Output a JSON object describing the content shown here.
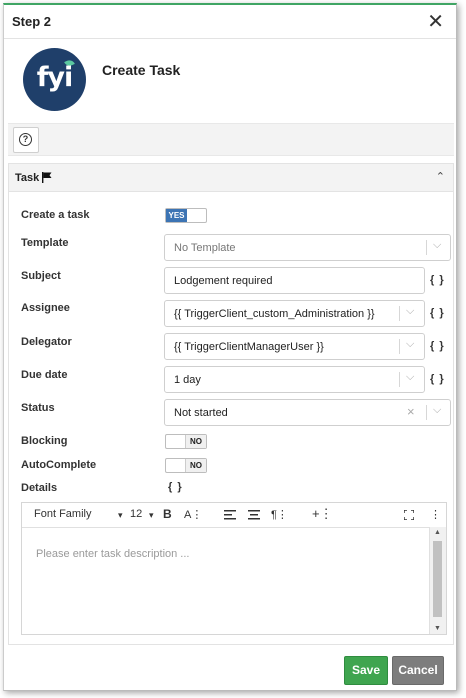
{
  "dialog": {
    "step_title": "Step 2",
    "close_label": "✕",
    "heading": "Create Task",
    "logo_text": "fyi"
  },
  "help": {
    "label": "?"
  },
  "task_panel": {
    "title": "Task",
    "collapse_icon": "chevron-up-icon",
    "fields": {
      "create_task": {
        "label": "Create a task",
        "toggle": "YES"
      },
      "template": {
        "label": "Template",
        "placeholder": "No Template"
      },
      "subject": {
        "label": "Subject",
        "value": "Lodgement required",
        "braces": "{ }"
      },
      "assignee": {
        "label": "Assignee",
        "value": "{{ TriggerClient_custom_Administration }}",
        "braces": "{ }"
      },
      "delegator": {
        "label": "Delegator",
        "value": "{{ TriggerClientManagerUser }}",
        "braces": "{ }"
      },
      "due_date": {
        "label": "Due date",
        "value": "1 day",
        "braces": "{ }"
      },
      "status": {
        "label": "Status",
        "value": "Not started"
      },
      "blocking": {
        "label": "Blocking",
        "toggle": "NO"
      },
      "autocomplete": {
        "label": "AutoComplete",
        "toggle": "NO"
      },
      "details": {
        "label": "Details",
        "braces": "{ }"
      }
    }
  },
  "editor": {
    "font_family": "Font Family",
    "font_size": "12",
    "placeholder": "Please enter task description ..."
  },
  "footer": {
    "save_label": "Save",
    "cancel_label": "Cancel"
  },
  "colors": {
    "accent_green": "#3fa54f",
    "toggle_blue": "#3c74b4",
    "logo_navy": "#1f3f6a"
  }
}
